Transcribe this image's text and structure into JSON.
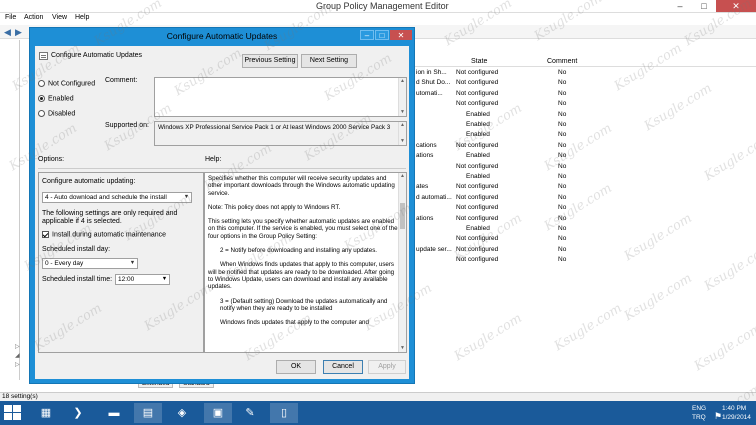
{
  "background": {
    "window_title": "Group Policy Management Editor",
    "menu": [
      "File",
      "Action",
      "View",
      "Help"
    ],
    "columns": {
      "state": "State",
      "comment": "Comment"
    },
    "rows": [
      {
        "setting": "ion in Sh...",
        "state": "Not configured",
        "comment": "No"
      },
      {
        "setting": "d Shut Do...",
        "state": "Not configured",
        "comment": "No"
      },
      {
        "setting": "utomati...",
        "state": "Not configured",
        "comment": "No"
      },
      {
        "setting": "",
        "state": "Not configured",
        "comment": "No"
      },
      {
        "setting": "",
        "state": "Enabled",
        "comment": "No"
      },
      {
        "setting": "",
        "state": "Enabled",
        "comment": "No"
      },
      {
        "setting": "",
        "state": "Enabled",
        "comment": "No"
      },
      {
        "setting": "cations",
        "state": "Not configured",
        "comment": "No"
      },
      {
        "setting": "ations",
        "state": "Enabled",
        "comment": "No"
      },
      {
        "setting": "",
        "state": "Not configured",
        "comment": "No"
      },
      {
        "setting": "",
        "state": "Enabled",
        "comment": "No"
      },
      {
        "setting": "ates",
        "state": "Not configured",
        "comment": "No"
      },
      {
        "setting": "d automati...",
        "state": "Not configured",
        "comment": "No"
      },
      {
        "setting": "",
        "state": "Not configured",
        "comment": "No"
      },
      {
        "setting": "ations",
        "state": "Not configured",
        "comment": "No"
      },
      {
        "setting": "",
        "state": "Enabled",
        "comment": "No"
      },
      {
        "setting": "",
        "state": "Not configured",
        "comment": "No"
      },
      {
        "setting": "update ser...",
        "state": "Not configured",
        "comment": "No"
      },
      {
        "setting": "",
        "state": "Not configured",
        "comment": "No"
      }
    ],
    "tabs": [
      "Extended",
      "Standard"
    ],
    "status": "18 setting(s)"
  },
  "watermark": "Ksugle.com",
  "dialog": {
    "title": "Configure Automatic Updates",
    "header_label": "Configure Automatic Updates",
    "prev_button": "Previous Setting",
    "next_button": "Next Setting",
    "radios": {
      "not_configured": "Not Configured",
      "enabled": "Enabled",
      "disabled": "Disabled",
      "selected": "enabled"
    },
    "comment_label": "Comment:",
    "comment_value": "",
    "supported_label": "Supported on:",
    "supported_value": "Windows XP Professional Service Pack 1 or At least Windows 2000 Service Pack 3",
    "options_label": "Options:",
    "help_label": "Help:",
    "options": {
      "configure_label": "Configure automatic updating:",
      "configure_value": "4 - Auto download and schedule the install",
      "note": "The following settings are only required and applicable if 4 is selected.",
      "maintenance_label": "Install during automatic maintenance",
      "maintenance_checked": true,
      "day_label": "Scheduled install day:",
      "day_value": "0 - Every day",
      "time_label": "Scheduled install time:",
      "time_value": "12:00"
    },
    "help": [
      "Specifies whether this computer will receive security updates and other important downloads through the Windows automatic updating service.",
      "Note: This policy does not apply to Windows RT.",
      "This setting lets you specify whether automatic updates are enabled on this computer. If the service is enabled, you must select one of the four options in the Group Policy Setting:",
      "2 = Notify before downloading and installing any updates.",
      "When Windows finds updates that apply to this computer, users will be notified that updates are ready to be downloaded. After going to Windows Update, users can download and install any available updates.",
      "3 = (Default setting) Download the updates automatically and notify when they are ready to be installed",
      "Windows finds updates that apply to the computer and"
    ],
    "ok_button": "OK",
    "cancel_button": "Cancel",
    "apply_button": "Apply"
  },
  "taskbar": {
    "lang": "ENG",
    "region": "TRQ",
    "time": "1:40 PM",
    "date": "1/29/2014"
  }
}
